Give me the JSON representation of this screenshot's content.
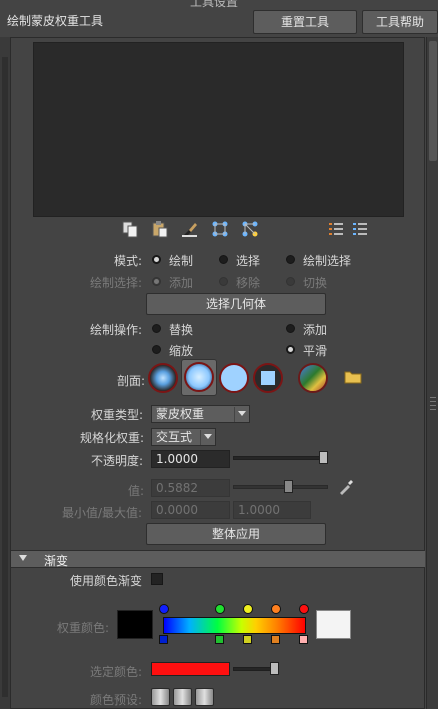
{
  "top_title_fragment": "工具设置",
  "window_title": "绘制蒙皮权重工具",
  "header_buttons": {
    "reset": "重置工具",
    "help": "工具帮助"
  },
  "mode": {
    "label": "模式:",
    "options": [
      "绘制",
      "选择",
      "绘制选择"
    ],
    "selected": "绘制"
  },
  "paint_select": {
    "label": "绘制选择:",
    "options": [
      "添加",
      "移除",
      "切换"
    ],
    "selected": "添加"
  },
  "select_geometry_button": "选择几何体",
  "paint_operation": {
    "label": "绘制操作:",
    "options": [
      "替换",
      "添加",
      "缩放",
      "平滑"
    ],
    "selected": "平滑"
  },
  "profile": {
    "label": "剖面:"
  },
  "weight_type": {
    "label": "权重类型:",
    "value": "蒙皮权重"
  },
  "normalize_weights": {
    "label": "规格化权重:",
    "value": "交互式"
  },
  "opacity": {
    "label": "不透明度:",
    "value": "1.0000",
    "slider_fraction": 1.0
  },
  "value": {
    "label": "值:",
    "value": "0.5882",
    "slider_fraction": 0.5882
  },
  "min_max": {
    "label": "最小值/最大值:",
    "min": "0.0000",
    "max": "1.0000"
  },
  "flood_button": "整体应用",
  "gradient_section": {
    "title": "渐变",
    "use_color_ramp_label": "使用颜色渐变",
    "use_color_ramp_checked": false,
    "weight_color_label": "权重颜色:",
    "ramp_colors": [
      "#0000ff",
      "#00ff40",
      "#ffff00",
      "#ff8000",
      "#ff0000"
    ],
    "selected_color_label": "选定颜色:",
    "selected_color": "#ff1010",
    "color_presets_label": "颜色预设:"
  },
  "icons": {
    "toolbar": [
      "copy-icon",
      "paste-icon",
      "brush-icon",
      "joint-icon",
      "joint-select-icon",
      "list-icon",
      "list-detail-icon"
    ],
    "profile": [
      "gaussian-brush-icon",
      "soft-brush-icon",
      "solid-brush-icon",
      "square-brush-icon",
      "image-brush-icon",
      "folder-icon"
    ]
  }
}
